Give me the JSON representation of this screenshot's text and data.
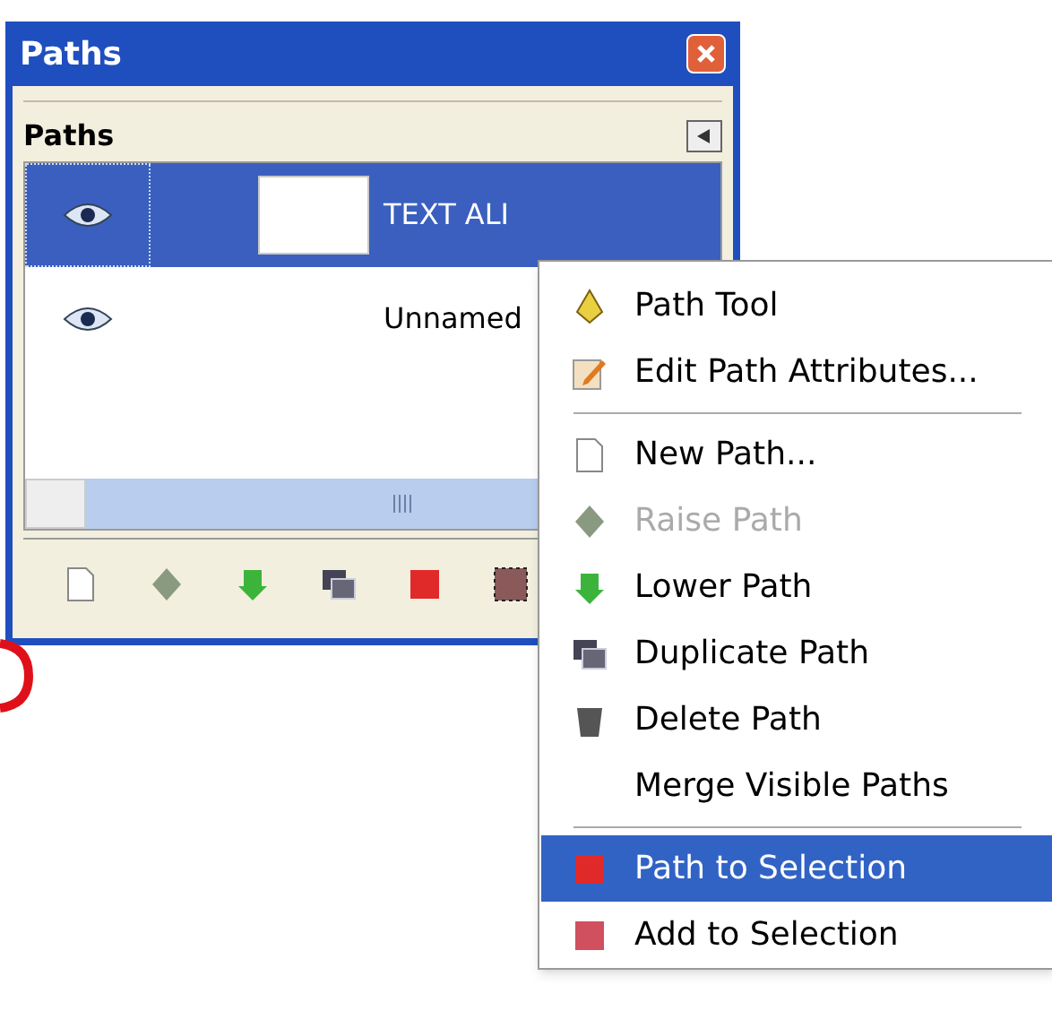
{
  "window": {
    "title": "Paths"
  },
  "panel": {
    "title": "Paths"
  },
  "paths": [
    {
      "name": "TEXT ALI",
      "visible": true,
      "selected": true,
      "thumbnail": true
    },
    {
      "name": "Unnamed",
      "visible": true,
      "selected": false,
      "thumbnail": false
    }
  ],
  "toolbar": [
    {
      "kind": "new"
    },
    {
      "kind": "raise"
    },
    {
      "kind": "lower"
    },
    {
      "kind": "duplicate"
    },
    {
      "kind": "selection"
    },
    {
      "kind": "checker"
    }
  ],
  "context_menu": [
    {
      "kind": "tool",
      "label": "Path Tool",
      "disabled": false,
      "selected": false
    },
    {
      "kind": "edit",
      "label": "Edit Path Attributes...",
      "disabled": false,
      "selected": false
    },
    {
      "kind": "separator"
    },
    {
      "kind": "new",
      "label": "New Path...",
      "disabled": false,
      "selected": false
    },
    {
      "kind": "raise",
      "label": "Raise Path",
      "disabled": true,
      "selected": false
    },
    {
      "kind": "lower",
      "label": "Lower Path",
      "disabled": false,
      "selected": false
    },
    {
      "kind": "duplicate",
      "label": "Duplicate Path",
      "disabled": false,
      "selected": false
    },
    {
      "kind": "delete",
      "label": "Delete Path",
      "disabled": false,
      "selected": false
    },
    {
      "kind": "plain",
      "label": "Merge Visible Paths",
      "disabled": false,
      "selected": false
    },
    {
      "kind": "separator"
    },
    {
      "kind": "selection",
      "label": "Path to Selection",
      "disabled": false,
      "selected": true
    },
    {
      "kind": "add",
      "label": "Add to Selection",
      "disabled": false,
      "selected": false
    }
  ]
}
